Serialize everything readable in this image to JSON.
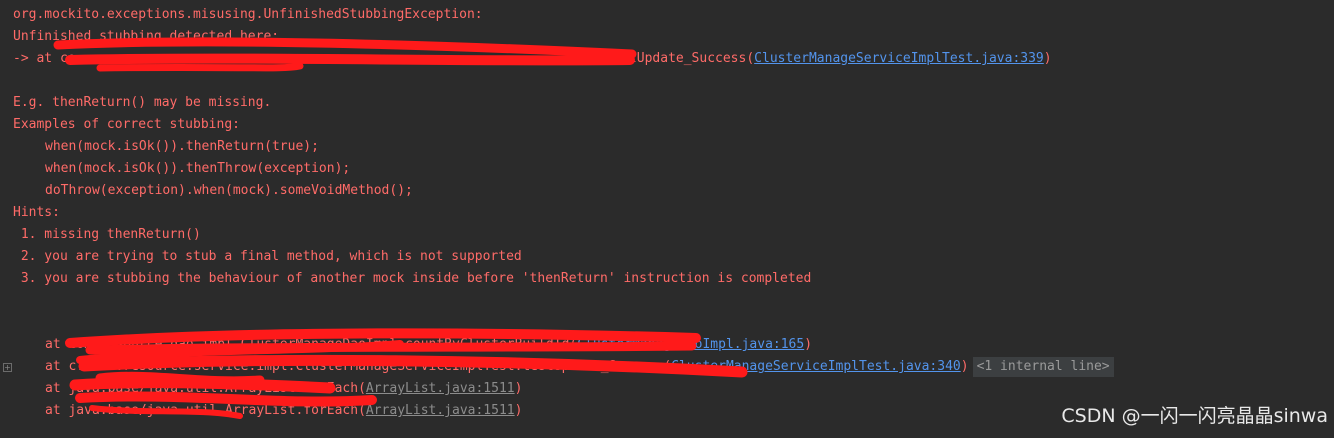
{
  "console": {
    "exception": "org.mockito.exceptions.misusing.UnfinishedStubbingException:",
    "detected": "Unfinished stubbing detected here:",
    "at_prefix": "-> at co",
    "at_method": ".testUpdate_Success(",
    "at_link": "ClusterManageServiceImplTest.java:339",
    "at_close": ")",
    "eg": "E.g. thenReturn() may be missing.",
    "examples_header": "Examples of correct stubbing:",
    "examples": [
      "when(mock.isOk()).thenReturn(true);",
      "when(mock.isOk()).thenThrow(exception);",
      "doThrow(exception).when(mock).someVoidMethod();"
    ],
    "hints_header": "Hints:",
    "hints": [
      " 1. missing thenReturn()",
      " 2. you are trying to stub a final method, which is not supported",
      " 3. you are stubbing the behaviour of another mock inside before 'thenReturn' instruction is completed"
    ],
    "trace": [
      {
        "prefix": "at com",
        "mid": ".resource.dao.impl.ClusterManageDaoImpl.countByClusterBuildId(",
        "link": "ClusterManageDaoImpl.java:165",
        "close": ")",
        "extra": ""
      },
      {
        "prefix": "at c.m.",
        "mid": "...resource.service.impl.ClusterManageServiceImplTest.testUpdate_Success(",
        "link": "ClusterManageServiceImplTest.java:340",
        "close": ")",
        "extra": "<1 internal line>"
      },
      {
        "prefix": "at java.base/java.util.ArrayList.forEach(",
        "mid": "",
        "link": "ArrayList.java:1511",
        "close": ")",
        "extra": ""
      },
      {
        "prefix": "at java.base/java.util.ArrayList.forEach(",
        "mid": "",
        "link": "ArrayList.java:1511",
        "close": ")",
        "extra": ""
      }
    ]
  },
  "watermark": "CSDN @一闪一闪亮晶晶sinwa",
  "colors": {
    "background": "#2b2b2b",
    "error_text": "#ff6b68",
    "link": "#5394ec",
    "redaction": "#ff1a1a"
  }
}
